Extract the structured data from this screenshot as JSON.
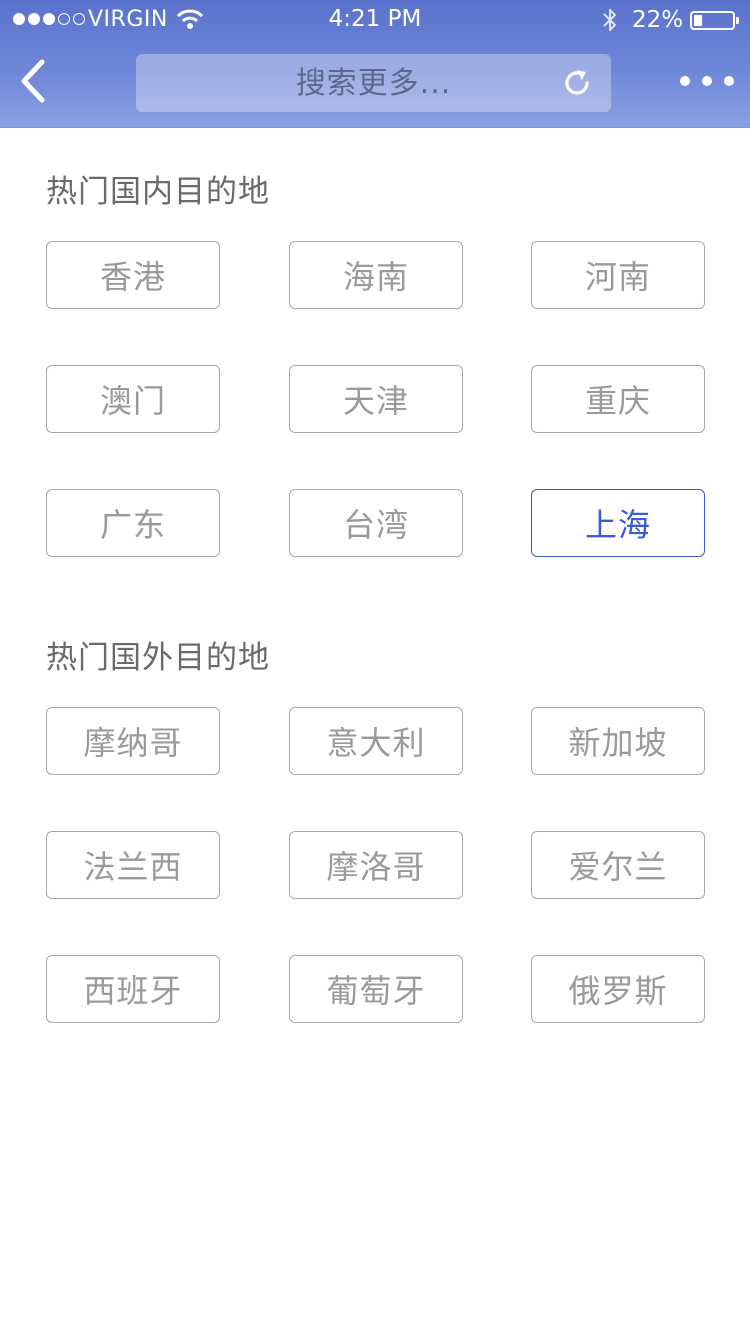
{
  "status_bar": {
    "carrier": "VIRGIN",
    "time": "4:21 PM",
    "battery_percent": "22%",
    "battery_level": 0.22,
    "signal_bars_filled": 3,
    "signal_bars_total": 5
  },
  "nav": {
    "back_icon": "chevron-left-icon",
    "search_placeholder": "搜索更多...",
    "refresh_icon": "refresh-icon",
    "more_icon": "more-horizontal-icon"
  },
  "domestic": {
    "title": "热门国内目的地",
    "items": [
      {
        "label": "香港"
      },
      {
        "label": "海南"
      },
      {
        "label": "河南"
      },
      {
        "label": "澳门"
      },
      {
        "label": "天津"
      },
      {
        "label": "重庆"
      },
      {
        "label": "广东"
      },
      {
        "label": "台湾"
      },
      {
        "label": "上海",
        "selected": true
      }
    ]
  },
  "international": {
    "title": "热门国外目的地",
    "items": [
      {
        "label": "摩纳哥"
      },
      {
        "label": "意大利"
      },
      {
        "label": "新加坡"
      },
      {
        "label": "法兰西"
      },
      {
        "label": "摩洛哥"
      },
      {
        "label": "爱尔兰"
      },
      {
        "label": "西班牙"
      },
      {
        "label": "葡萄牙"
      },
      {
        "label": "俄罗斯"
      }
    ]
  },
  "colors": {
    "header_gradient_top": "#5a72cc",
    "header_gradient_bottom": "#8ba0e2",
    "accent": "#3a5bd9",
    "chip_border": "#a9a9a9",
    "chip_text": "#9a9a9a"
  }
}
